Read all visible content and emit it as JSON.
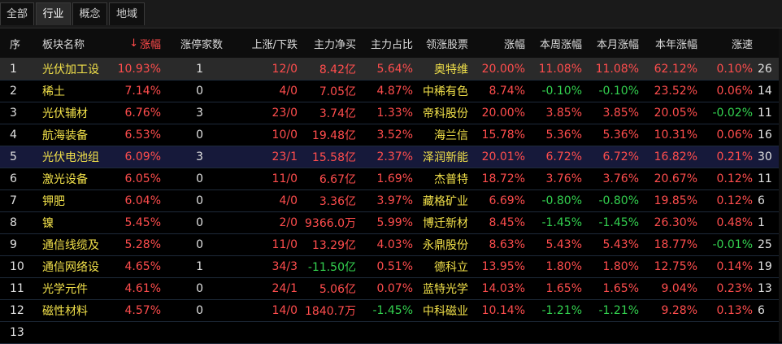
{
  "tabs": [
    {
      "label": "全部",
      "active": false
    },
    {
      "label": "行业",
      "active": true
    },
    {
      "label": "概念",
      "active": false
    },
    {
      "label": "地域",
      "active": false
    }
  ],
  "columns": {
    "idx": "序",
    "name": "板块名称",
    "chg": "涨幅",
    "limit": "涨停家数",
    "updown": "上涨/下跌",
    "netbuy": "主力净买",
    "ratio": "主力占比",
    "leader": "领涨股票",
    "lchg": "涨幅",
    "week": "本周涨幅",
    "month": "本月涨幅",
    "year": "本年涨幅",
    "speed": "涨速",
    "extra": ""
  },
  "sort_indicator": "↓",
  "colors": {
    "up": "#ff4d4d",
    "down": "#33d14f",
    "name": "#f2e14a",
    "selected_row_gray": "#2a2a2a",
    "selected_row_blue": "#16193a"
  },
  "rows": [
    {
      "idx": "1",
      "name": "光伏加工设",
      "chg": "10.93%",
      "limit": "1",
      "updown": "12/0",
      "netbuy": "8.42亿",
      "ratio": "5.64%",
      "leader": "奥特维",
      "lchg": "20.00%",
      "week": "11.08%",
      "month": "11.08%",
      "year": "62.12%",
      "speed": "0.10%",
      "extra": "26",
      "highlight": "gray"
    },
    {
      "idx": "2",
      "name": "稀土",
      "chg": "7.14%",
      "limit": "0",
      "updown": "4/0",
      "netbuy": "7.05亿",
      "ratio": "4.87%",
      "leader": "中稀有色",
      "lchg": "8.74%",
      "week": "-0.10%",
      "month": "-0.10%",
      "year": "23.52%",
      "speed": "0.06%",
      "extra": "14",
      "highlight": ""
    },
    {
      "idx": "3",
      "name": "光伏辅材",
      "chg": "6.76%",
      "limit": "3",
      "updown": "23/0",
      "netbuy": "3.74亿",
      "ratio": "1.33%",
      "leader": "帝科股份",
      "lchg": "20.00%",
      "week": "3.85%",
      "month": "3.85%",
      "year": "20.05%",
      "speed": "-0.02%",
      "extra": "11",
      "highlight": ""
    },
    {
      "idx": "4",
      "name": "航海装备",
      "chg": "6.53%",
      "limit": "0",
      "updown": "10/0",
      "netbuy": "19.48亿",
      "ratio": "3.52%",
      "leader": "海兰信",
      "lchg": "15.78%",
      "week": "5.36%",
      "month": "5.36%",
      "year": "10.31%",
      "speed": "0.06%",
      "extra": "16",
      "highlight": ""
    },
    {
      "idx": "5",
      "name": "光伏电池组",
      "chg": "6.09%",
      "limit": "3",
      "updown": "23/1",
      "netbuy": "15.58亿",
      "ratio": "2.37%",
      "leader": "泽润新能",
      "lchg": "20.01%",
      "week": "6.72%",
      "month": "6.72%",
      "year": "16.82%",
      "speed": "0.21%",
      "extra": "30",
      "highlight": "blue"
    },
    {
      "idx": "6",
      "name": "激光设备",
      "chg": "6.05%",
      "limit": "0",
      "updown": "11/0",
      "netbuy": "6.67亿",
      "ratio": "1.69%",
      "leader": "杰普特",
      "lchg": "18.72%",
      "week": "3.76%",
      "month": "3.76%",
      "year": "20.67%",
      "speed": "0.12%",
      "extra": "11",
      "highlight": ""
    },
    {
      "idx": "7",
      "name": "钾肥",
      "chg": "6.04%",
      "limit": "0",
      "updown": "4/0",
      "netbuy": "3.36亿",
      "ratio": "3.97%",
      "leader": "藏格矿业",
      "lchg": "6.69%",
      "week": "-0.80%",
      "month": "-0.80%",
      "year": "19.85%",
      "speed": "0.12%",
      "extra": "6",
      "highlight": ""
    },
    {
      "idx": "8",
      "name": "镍",
      "chg": "5.45%",
      "limit": "0",
      "updown": "2/0",
      "netbuy": "9366.0万",
      "ratio": "5.99%",
      "leader": "博迁新材",
      "lchg": "8.45%",
      "week": "-1.45%",
      "month": "-1.45%",
      "year": "26.30%",
      "speed": "0.48%",
      "extra": "1",
      "highlight": ""
    },
    {
      "idx": "9",
      "name": "通信线缆及",
      "chg": "5.28%",
      "limit": "0",
      "updown": "11/0",
      "netbuy": "13.29亿",
      "ratio": "4.03%",
      "leader": "永鼎股份",
      "lchg": "8.63%",
      "week": "5.43%",
      "month": "5.43%",
      "year": "18.77%",
      "speed": "-0.01%",
      "extra": "25",
      "highlight": ""
    },
    {
      "idx": "10",
      "name": "通信网络设",
      "chg": "4.65%",
      "limit": "1",
      "updown": "34/3",
      "netbuy": "-11.50亿",
      "ratio": "0.51%",
      "leader": "德科立",
      "lchg": "13.95%",
      "week": "1.80%",
      "month": "1.80%",
      "year": "12.75%",
      "speed": "0.14%",
      "extra": "19",
      "highlight": ""
    },
    {
      "idx": "11",
      "name": "光学元件",
      "chg": "4.61%",
      "limit": "0",
      "updown": "24/1",
      "netbuy": "5.06亿",
      "ratio": "0.07%",
      "leader": "蓝特光学",
      "lchg": "14.03%",
      "week": "1.65%",
      "month": "1.65%",
      "year": "9.04%",
      "speed": "0.23%",
      "extra": "13",
      "highlight": ""
    },
    {
      "idx": "12",
      "name": "磁性材料",
      "chg": "4.57%",
      "limit": "0",
      "updown": "14/0",
      "netbuy": "1840.7万",
      "ratio": "-1.45%",
      "leader": "中科磁业",
      "lchg": "10.14%",
      "week": "-1.21%",
      "month": "-1.21%",
      "year": "9.28%",
      "speed": "0.13%",
      "extra": "6",
      "highlight": ""
    },
    {
      "idx": "13",
      "name": "",
      "chg": "",
      "limit": "",
      "updown": "",
      "netbuy": "",
      "ratio": "",
      "leader": "",
      "lchg": "",
      "week": "",
      "month": "",
      "year": "",
      "speed": "",
      "extra": "",
      "highlight": ""
    }
  ]
}
